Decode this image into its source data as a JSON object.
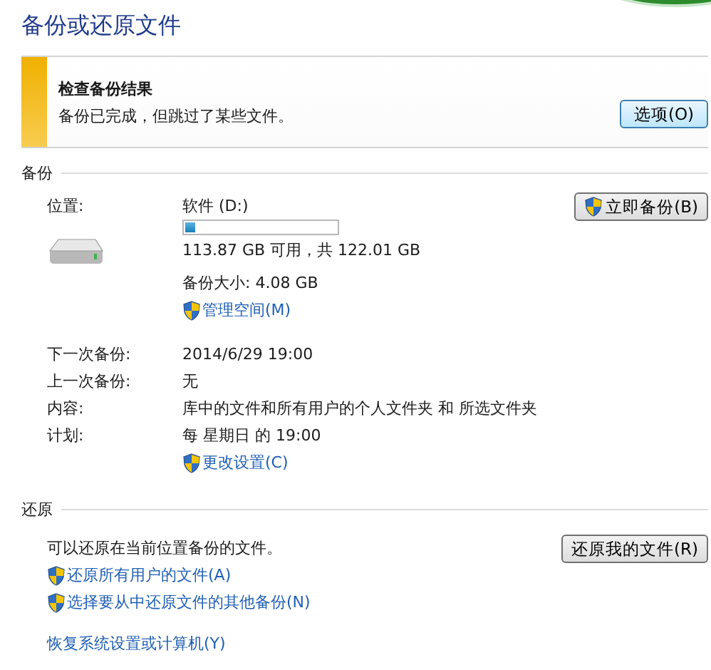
{
  "title": "备份或还原文件",
  "alert": {
    "heading": "检查备份结果",
    "message": "备份已完成，但跳过了某些文件。",
    "button": "选项(O)"
  },
  "backup": {
    "heading": "备份",
    "location_label": "位置:",
    "drive": "软件 (D:)",
    "usage": {
      "level": 0.07
    },
    "free_space": "113.87 GB 可用，共 122.01 GB",
    "backup_size": "备份大小: 4.08 GB",
    "manage_link": {
      "label": "管理空间(M)",
      "shield": true
    },
    "button": {
      "label": "立即备份(B)",
      "shield": true
    },
    "details": [
      {
        "label": "下一次备份:",
        "value": "2014/6/29 19:00"
      },
      {
        "label": "上一次备份:",
        "value": "无"
      },
      {
        "label": "内容:",
        "value": "库中的文件和所有用户的个人文件夹 和 所选文件夹"
      },
      {
        "label": "计划:",
        "value": "每 星期日 的 19:00"
      }
    ],
    "settings_link": {
      "label": "更改设置(C)",
      "shield": true
    }
  },
  "restore": {
    "heading": "还原",
    "message": "可以还原在当前位置备份的文件。",
    "button": {
      "label": "还原我的文件(R)",
      "shield": false
    },
    "links": [
      {
        "label": "还原所有用户的文件(A)",
        "shield": true
      },
      {
        "label": "选择要从中还原文件的其他备份(N)",
        "shield": true
      }
    ],
    "recovery_link": "恢复系统设置或计算机(Y)"
  }
}
